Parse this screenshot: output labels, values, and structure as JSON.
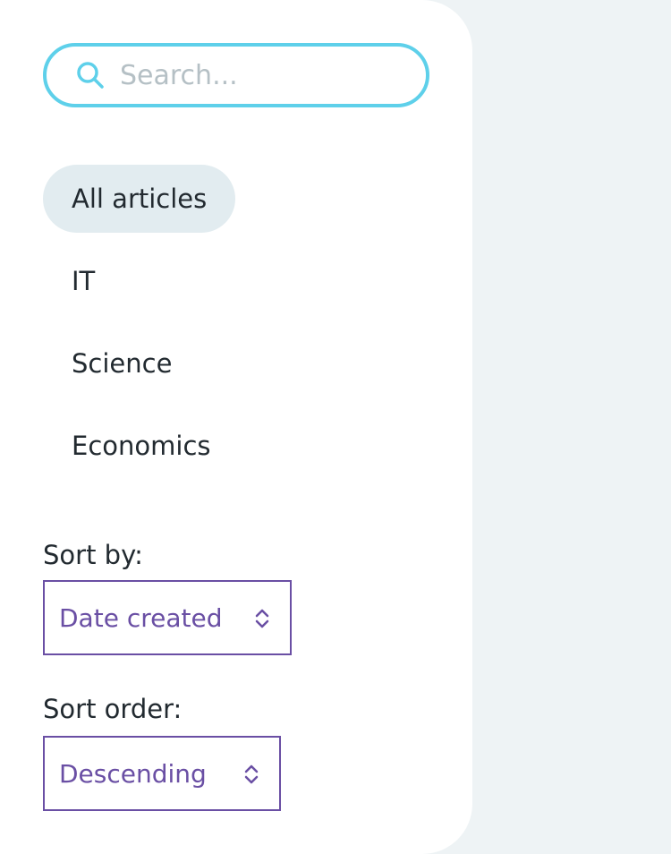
{
  "search": {
    "placeholder": "Search...",
    "icon": "search-icon"
  },
  "categories": [
    {
      "label": "All articles",
      "active": true
    },
    {
      "label": "IT",
      "active": false
    },
    {
      "label": "Science",
      "active": false
    },
    {
      "label": "Economics",
      "active": false
    }
  ],
  "sort_by": {
    "label": "Sort by:",
    "selected": "Date created"
  },
  "sort_order": {
    "label": "Sort order:",
    "selected": "Descending"
  },
  "colors": {
    "search_border": "#5ed0ea",
    "select_accent": "#6a4fa4",
    "active_pill": "#e2ecf0",
    "background": "#eef3f5"
  }
}
